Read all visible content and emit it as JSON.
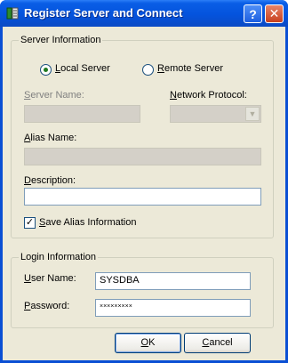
{
  "window": {
    "title": "Register Server and Connect",
    "help_symbol": "?",
    "close_symbol": "✕"
  },
  "server_info": {
    "group_label": "Server Information",
    "local_server": {
      "accel": "L",
      "rest": "ocal Server",
      "selected": true
    },
    "remote_server": {
      "accel": "R",
      "rest": "emote Server",
      "selected": false
    },
    "server_name": {
      "accel": "S",
      "rest": "erver Name:",
      "value": ""
    },
    "network_protocol": {
      "accel": "N",
      "rest": "etwork Protocol:",
      "value": ""
    },
    "alias_name": {
      "accel": "A",
      "rest": "lias Name:",
      "value": ""
    },
    "description": {
      "accel": "D",
      "rest": "escription:",
      "value": ""
    },
    "save_alias": {
      "accel": "S",
      "rest": "ave Alias Information",
      "checked": true,
      "check_glyph": "✓"
    }
  },
  "login_info": {
    "group_label": "Login Information",
    "user_name": {
      "accel": "U",
      "rest": "ser Name:",
      "value": "SYSDBA"
    },
    "password": {
      "accel": "P",
      "rest": "assword:",
      "value": "×××××××××"
    }
  },
  "buttons": {
    "ok": {
      "accel": "O",
      "rest": "K"
    },
    "cancel": {
      "accel": "C",
      "rest": "ancel"
    }
  },
  "colors": {
    "title_bar": "#0453dd",
    "dialog_face": "#ece9d8",
    "close_button": "#c8401e"
  }
}
